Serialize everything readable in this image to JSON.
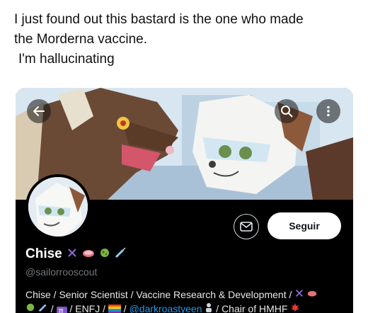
{
  "tweet": {
    "line1": "I just found out this bastard is the one who made",
    "line2": "the Morderna vaccine.",
    "line3": "I'm hallucinating"
  },
  "profile": {
    "display_name": "Chise",
    "name_emojis": [
      "dna-emoji",
      "petri-dish-emoji",
      "microbe-emoji",
      "syringe-emoji"
    ],
    "handle": "@sailorrooscout",
    "follow_label": "Seguir",
    "bio": {
      "line1": "Chise / Senior Scientist / Vaccine Research & Development /",
      "line2_segments": [
        "/",
        "/ ENFJ /",
        "/",
        "@darkroastyeen",
        "/ Chair of HMHF"
      ]
    }
  },
  "colors": {
    "card_bg": "#000000",
    "mention": "#1d9bf0",
    "handle": "#71767b",
    "follow_bg": "#ffffff"
  },
  "icons": {
    "back": "arrow-left-icon",
    "search": "search-icon",
    "more": "more-vertical-icon",
    "message": "envelope-icon"
  }
}
